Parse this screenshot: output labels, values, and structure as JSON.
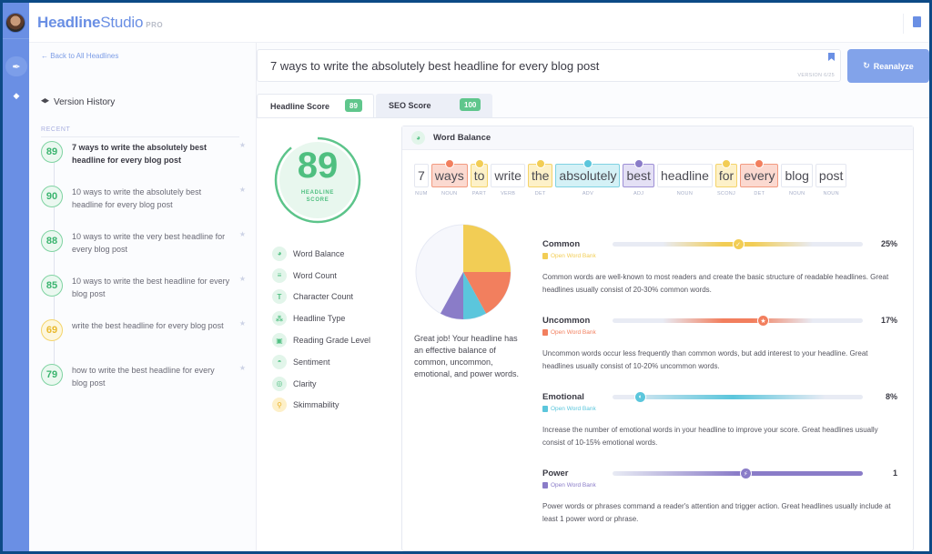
{
  "app": {
    "name_bold": "Headline",
    "name_light": "Studio",
    "tier": "PRO"
  },
  "rail": {
    "items": [
      {
        "icon": "feather-icon",
        "active": true
      },
      {
        "icon": "graduation-cap-icon",
        "active": false
      }
    ]
  },
  "left": {
    "back_link": "← Back to All Headlines",
    "version_history_title": "Version History",
    "recent_label": "RECENT",
    "versions": [
      {
        "score": "89",
        "text": "7 ways to write the absolutely best headline for every blog post",
        "current": true,
        "status": "good"
      },
      {
        "score": "90",
        "text": "10 ways to write the absolutely best headline for every blog post",
        "current": false,
        "status": "good"
      },
      {
        "score": "88",
        "text": "10 ways to write the very best headline for every blog post",
        "current": false,
        "status": "good"
      },
      {
        "score": "85",
        "text": "10 ways to write the best headline for every blog post",
        "current": false,
        "status": "good"
      },
      {
        "score": "69",
        "text": "write the best headline for every blog post",
        "current": false,
        "status": "warn"
      },
      {
        "score": "79",
        "text": "how to write the best headline for every blog post",
        "current": false,
        "status": "good"
      }
    ]
  },
  "editor": {
    "headline_value": "7 ways to write the absolutely best headline for every blog post",
    "version_label": "VERSION 6/25",
    "reanalyze_label": "Reanalyze"
  },
  "tabs": [
    {
      "label": "Headline Score",
      "badge": "89",
      "active": true
    },
    {
      "label": "SEO Score",
      "badge": "100",
      "active": false
    }
  ],
  "score": {
    "value": "89",
    "percent": 89,
    "label_line1": "HEADLINE",
    "label_line2": "SCORE",
    "color": "#5cc48a"
  },
  "metrics": [
    {
      "label": "Word Balance",
      "icon": "pie-icon",
      "glyph": "◕",
      "status": "good"
    },
    {
      "label": "Word Count",
      "icon": "lines-icon",
      "glyph": "≡",
      "status": "good"
    },
    {
      "label": "Character Count",
      "icon": "text-t-icon",
      "glyph": "T",
      "status": "good"
    },
    {
      "label": "Headline Type",
      "icon": "shapes-icon",
      "glyph": "⁂",
      "status": "good"
    },
    {
      "label": "Reading Grade Level",
      "icon": "book-open-icon",
      "glyph": "▣",
      "status": "good"
    },
    {
      "label": "Sentiment",
      "icon": "smile-icon",
      "glyph": "◓",
      "status": "good"
    },
    {
      "label": "Clarity",
      "icon": "target-icon",
      "glyph": "◎",
      "status": "good"
    },
    {
      "label": "Skimmability",
      "icon": "magnifier-icon",
      "glyph": "⚲",
      "status": "warn"
    }
  ],
  "word_balance": {
    "title": "Word Balance",
    "tokens": [
      {
        "word": "7",
        "pos": "NUM",
        "type": "none"
      },
      {
        "word": "ways",
        "pos": "NOUN",
        "type": "uncommon"
      },
      {
        "word": "to",
        "pos": "PART",
        "type": "common"
      },
      {
        "word": "write",
        "pos": "VERB",
        "type": "none"
      },
      {
        "word": "the",
        "pos": "DET",
        "type": "common"
      },
      {
        "word": "absolutely",
        "pos": "ADV",
        "type": "emotional"
      },
      {
        "word": "best",
        "pos": "ADJ",
        "type": "power"
      },
      {
        "word": "headline",
        "pos": "NOUN",
        "type": "none"
      },
      {
        "word": "for",
        "pos": "SCONJ",
        "type": "common"
      },
      {
        "word": "every",
        "pos": "DET",
        "type": "uncommon"
      },
      {
        "word": "blog",
        "pos": "NOUN",
        "type": "none"
      },
      {
        "word": "post",
        "pos": "NOUN",
        "type": "none"
      }
    ],
    "message": "Great job! Your headline has an effective balance of common, uncommon, emotional, and power words.",
    "colors": {
      "common": "#f2cd55",
      "uncommon": "#f27f5e",
      "emotional": "#5bc6dc",
      "power": "#8a7cc8",
      "empty": "#f6f7fc"
    },
    "pie": [
      {
        "name": "Common",
        "percent": 25
      },
      {
        "name": "Uncommon",
        "percent": 17
      },
      {
        "name": "Emotional",
        "percent": 8
      },
      {
        "name": "Power",
        "percent": 8
      }
    ],
    "categories": [
      {
        "key": "common",
        "name": "Common",
        "value": "25%",
        "position": 0.5,
        "knob": "✓",
        "link": "Open Word Bank",
        "description": "Common words are well-known to most readers and create the basic structure of readable headlines. Great headlines usually consist of 20-30% common words."
      },
      {
        "key": "uncommon",
        "name": "Uncommon",
        "value": "17%",
        "position": 0.6,
        "knob": "★",
        "link": "Open Word Bank",
        "description": "Uncommon words occur less frequently than common words, but add interest to your headline. Great headlines usually consist of 10-20% uncommon words."
      },
      {
        "key": "emotional",
        "name": "Emotional",
        "value": "8%",
        "position": 0.11,
        "knob": "◐",
        "link": "Open Word Bank",
        "description": "Increase the number of emotional words in your headline to improve your score. Great headlines usually consist of 10-15% emotional words."
      },
      {
        "key": "power",
        "name": "Power",
        "value": "1",
        "position": 0.53,
        "knob": "⚡",
        "link": "Open Word Bank",
        "description": "Power words or phrases command a reader's attention and trigger action. Great headlines usually include at least 1 power word or phrase."
      }
    ]
  }
}
